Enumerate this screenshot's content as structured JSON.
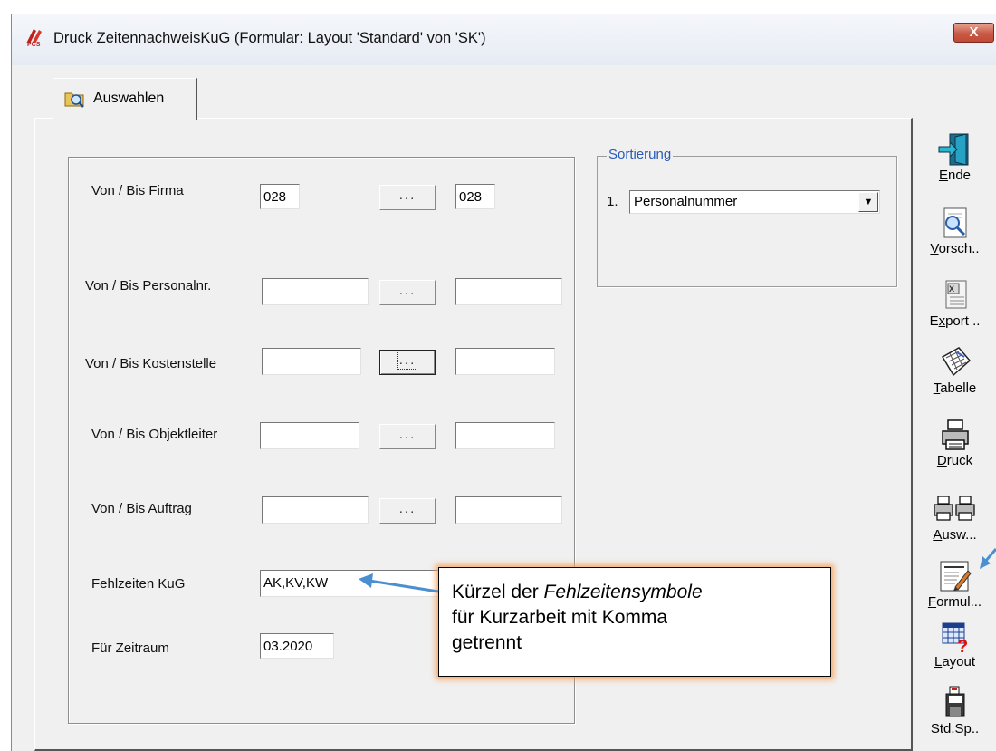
{
  "window": {
    "title": "Druck ZeitennachweisKuG    (Formular: Layout 'Standard' von 'SK')",
    "close_label": "X"
  },
  "tab": {
    "label": "Auswahlen"
  },
  "form": {
    "firma": {
      "label": "Von / Bis Firma",
      "from": "028",
      "to": "028",
      "picker": "..."
    },
    "personalnr": {
      "label": "Von / Bis Personalnr.",
      "from": "",
      "to": "",
      "picker": "..."
    },
    "kostenstelle": {
      "label": "Von / Bis Kostenstelle",
      "from": "",
      "to": "",
      "picker": "..."
    },
    "objektleiter": {
      "label": "Von / Bis Objektleiter",
      "from": "",
      "to": "",
      "picker": "..."
    },
    "auftrag": {
      "label": "Von / Bis Auftrag",
      "from": "",
      "to": "",
      "picker": "..."
    },
    "fehlzeiten": {
      "label": "Fehlzeiten KuG",
      "value": "AK,KV,KW"
    },
    "zeitraum": {
      "label": "Für Zeitraum",
      "value": "03.2020"
    }
  },
  "sortierung": {
    "legend": "Sortierung",
    "index": "1.",
    "selected": "Personalnummer"
  },
  "toolbar": {
    "ende": {
      "underline": "E",
      "rest": "nde",
      "icon": "exit-door-icon"
    },
    "vorschau": {
      "underline": "V",
      "rest": "orsch..",
      "icon": "preview-magnifier-icon"
    },
    "export": {
      "pre": "E",
      "underline": "x",
      "rest": "port ..",
      "icon": "excel-export-icon"
    },
    "tabelle": {
      "underline": "T",
      "rest": "abelle",
      "icon": "table-icon"
    },
    "druck": {
      "underline": "D",
      "rest": "ruck",
      "icon": "printer-icon"
    },
    "auswahl": {
      "underline": "A",
      "rest": "usw...",
      "icon": "double-printer-icon"
    },
    "formular": {
      "underline": "F",
      "rest": "ormul...",
      "icon": "form-edit-icon"
    },
    "layout": {
      "underline": "L",
      "rest": "ayout",
      "icon": "layout-help-icon"
    },
    "std": {
      "label": "Std.Sp..",
      "icon": "save-standard-icon"
    }
  },
  "callout": {
    "line1_pre": "Kürzel der ",
    "line1_em": "Fehlzeitensymbole",
    "line2": "für Kurzarbeit mit Komma",
    "line3": "getrennt"
  },
  "colors": {
    "legend_blue": "#2a5bb8",
    "callout_glow": "#f5a05a",
    "arrow": "#4a8fd0",
    "close_red": "#c75a46"
  }
}
